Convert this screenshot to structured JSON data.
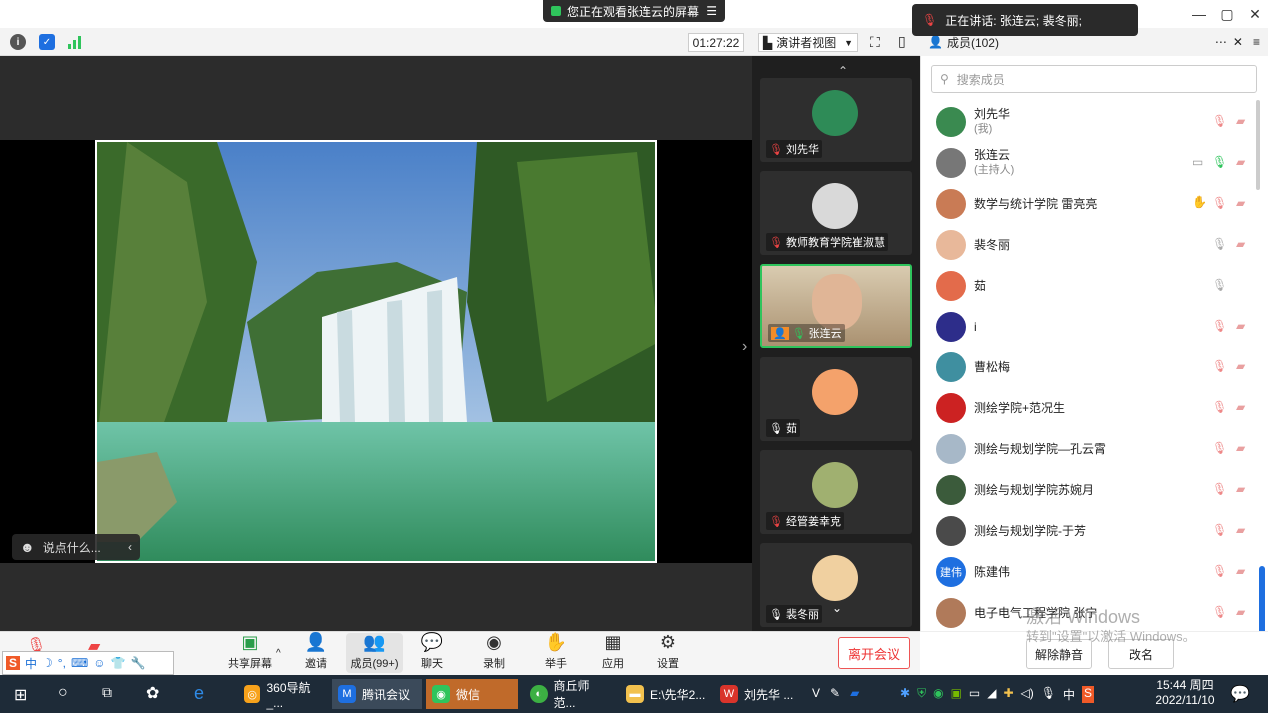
{
  "banner": {
    "text": "您正在观看张连云的屏幕",
    "menu_icon": "menu-icon"
  },
  "speaking": {
    "text": "正在讲话: 张连云; 裴冬丽;"
  },
  "toolbar": {
    "timer": "01:27:22",
    "view_label": "演讲者视图"
  },
  "stage": {
    "chat_placeholder": "说点什么..."
  },
  "tiles": [
    {
      "name": "刘先华",
      "muted": true,
      "color": "#2e8b57"
    },
    {
      "name": "教师教育学院崔淑慧",
      "muted": true,
      "color": "#d9d9d9"
    },
    {
      "name": "张连云",
      "muted": false,
      "color": "#6b8fa3"
    },
    {
      "name": "茹",
      "muted": false,
      "color": "#f4a26b"
    },
    {
      "name": "经管姜幸克",
      "muted": true,
      "color": "#a0b070"
    },
    {
      "name": "裴冬丽",
      "muted": false,
      "color": "#f0d0a0"
    }
  ],
  "panel": {
    "title": "成员(102)",
    "search_placeholder": "搜索成员",
    "members": [
      {
        "name": "刘先华",
        "role": "(我)",
        "color": "#3a8a50"
      },
      {
        "name": "张连云",
        "role": "(主持人)",
        "color": "#777777"
      },
      {
        "name": "数学与统计学院 雷亮亮",
        "role": "",
        "color": "#c97b55"
      },
      {
        "name": "裴冬丽",
        "role": "",
        "color": "#e8b89a"
      },
      {
        "name": "茹",
        "role": "",
        "color": "#e36b4b"
      },
      {
        "name": "i",
        "role": "",
        "color": "#2d2d8a"
      },
      {
        "name": "曹松梅",
        "role": "",
        "color": "#3f8fa0"
      },
      {
        "name": "测绘学院+范况生",
        "role": "",
        "color": "#cc2222"
      },
      {
        "name": "测绘与规划学院—孔云霄",
        "role": "",
        "color": "#a7b8c8"
      },
      {
        "name": "测绘与规划学院苏婉月",
        "role": "",
        "color": "#3b5b3b"
      },
      {
        "name": "测绘与规划学院-于芳",
        "role": "",
        "color": "#4a4a4a"
      },
      {
        "name": "陈建伟",
        "role": "",
        "avatar_text": "建伟",
        "color": "#1e6fe0"
      },
      {
        "name": "电子电气工程学院 张宁",
        "role": "",
        "color": "#b07a5a"
      }
    ],
    "unmute_all": "解除静音",
    "rename": "改名"
  },
  "bottombar": {
    "share": "共享屏幕",
    "invite": "邀请",
    "members": "成员(99+)",
    "chat": "聊天",
    "record": "录制",
    "raise_hand": "举手",
    "apps": "应用",
    "settings": "设置",
    "leave": "离开会议"
  },
  "ime": {
    "lang": "中"
  },
  "watermark": {
    "line1": "激活 Windows",
    "line2": "转到\"设置\"以激活 Windows。"
  },
  "taskbar": {
    "items": [
      "360导航_...",
      "腾讯会议",
      "微信",
      "商丘师范...",
      "E:\\先华2...",
      "刘先华 ..."
    ],
    "tray_lang": "中",
    "time": "15:44 周四",
    "date": "2022/11/10"
  }
}
